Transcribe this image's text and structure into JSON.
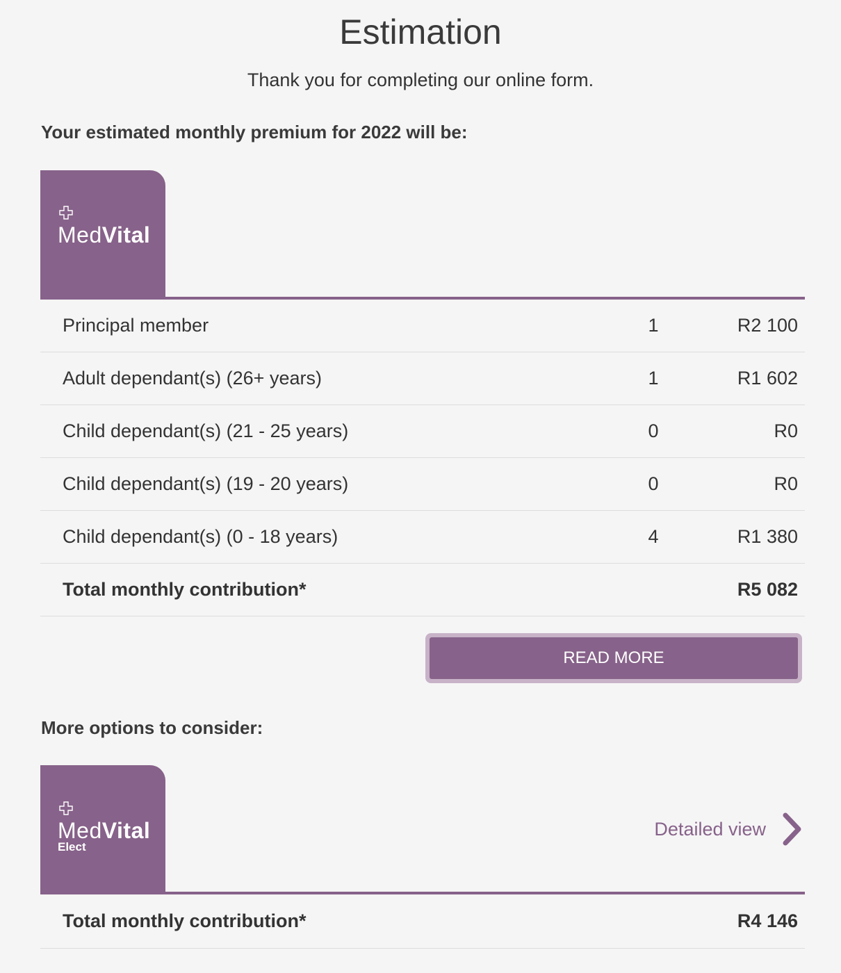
{
  "header": {
    "title": "Estimation",
    "subtitle": "Thank you for completing our online form."
  },
  "estimate": {
    "heading": "Your estimated monthly premium for 2022 will be:",
    "plan_logo": {
      "name_light": "Med",
      "name_bold": "Vital",
      "icon": "cross-outline-icon"
    },
    "rows": [
      {
        "label": "Principal member",
        "qty": "1",
        "amount": "R2 100"
      },
      {
        "label": "Adult dependant(s) (26+ years)",
        "qty": "1",
        "amount": "R1 602"
      },
      {
        "label": "Child dependant(s) (21 - 25 years)",
        "qty": "0",
        "amount": "R0"
      },
      {
        "label": "Child dependant(s) (19 - 20 years)",
        "qty": "0",
        "amount": "R0"
      },
      {
        "label": "Child dependant(s) (0 - 18 years)",
        "qty": "4",
        "amount": "R1 380"
      }
    ],
    "total": {
      "label": "Total monthly contribution*",
      "amount": "R5 082"
    },
    "read_more_label": "READ MORE"
  },
  "options": {
    "heading": "More options to consider:",
    "plan_logo": {
      "name_light": "Med",
      "name_bold": "Vital",
      "sub": "Elect",
      "icon": "cross-outline-icon"
    },
    "detailed_view_label": "Detailed view",
    "detailed_view_icon": "chevron-right-icon",
    "total": {
      "label": "Total monthly contribution*",
      "amount": "R4 146"
    }
  },
  "colors": {
    "brand_purple": "#87628a",
    "button_border": "#c7b2c8",
    "background": "#f5f5f5",
    "divider": "#dddddd"
  }
}
